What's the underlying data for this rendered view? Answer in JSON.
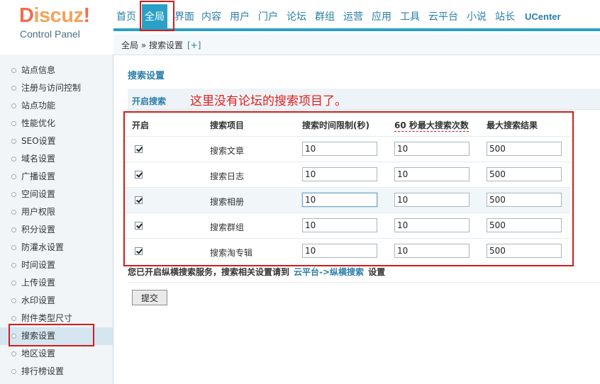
{
  "logo": {
    "word_d": "D",
    "word_rest": "iscuz",
    "word_ex": "!",
    "subtitle": "Control Panel"
  },
  "topnav": [
    "首页",
    "全局",
    "界面",
    "内容",
    "用户",
    "门户",
    "论坛",
    "群组",
    "运营",
    "应用",
    "工具",
    "云平台",
    "小说",
    "站长",
    "UCenter"
  ],
  "breadcrumb": {
    "text": "全局 » 搜索设置",
    "add": "[+]"
  },
  "sidebar": [
    "站点信息",
    "注册与访问控制",
    "站点功能",
    "性能优化",
    "SEO设置",
    "域名设置",
    "广播设置",
    "空间设置",
    "用户权限",
    "积分设置",
    "防灌水设置",
    "时间设置",
    "上传设置",
    "水印设置",
    "附件类型尺寸",
    "搜索设置",
    "地区设置",
    "排行榜设置"
  ],
  "page": {
    "title": "搜索设置",
    "section_title": "开启搜索",
    "annotation": "这里没有论坛的搜索项目了。"
  },
  "table": {
    "headers": [
      "开启",
      "搜索项目",
      "搜索时间限制(秒)",
      "60 秒最大搜索次数",
      "最大搜索结果"
    ],
    "rows": [
      {
        "label": "搜索文章",
        "time_limit": "10",
        "max_per_60s": "10",
        "max_results": "500",
        "enabled": true
      },
      {
        "label": "搜索日志",
        "time_limit": "10",
        "max_per_60s": "10",
        "max_results": "500",
        "enabled": true
      },
      {
        "label": "搜索相册",
        "time_limit": "10",
        "max_per_60s": "10",
        "max_results": "500",
        "enabled": true
      },
      {
        "label": "搜索群组",
        "time_limit": "10",
        "max_per_60s": "10",
        "max_results": "500",
        "enabled": true
      },
      {
        "label": "搜索淘专辑",
        "time_limit": "10",
        "max_per_60s": "10",
        "max_results": "500",
        "enabled": true
      }
    ]
  },
  "note": {
    "prefix": "您已开启纵横搜索服务，搜索相关设置请到",
    "link": "云平台->纵横搜索",
    "suffix": "设置"
  },
  "submit_label": "提交",
  "colors": {
    "accent": "#2aa0c7",
    "link": "#2a7ea8",
    "highlight": "#d01c1c"
  }
}
